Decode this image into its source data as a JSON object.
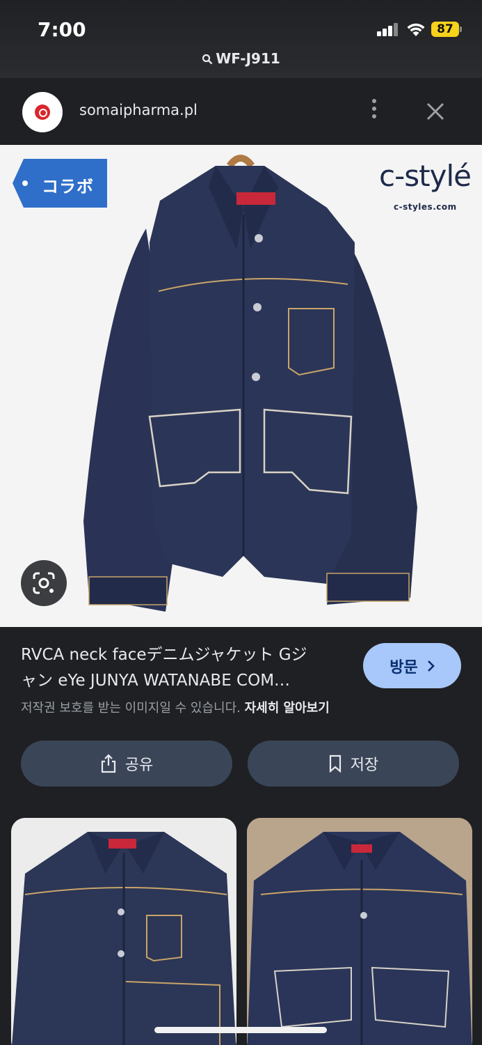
{
  "status_bar": {
    "time": "7:00",
    "battery": "87",
    "search_query": "WF-J911"
  },
  "source": {
    "domain": "somaipharma.pl",
    "favicon": "somaipharma-logo",
    "menu_icon": "more-vert-icon",
    "close_icon": "close-icon"
  },
  "image": {
    "badge_label": "コラボ",
    "watermark": "c-stylé",
    "watermark_url": "c-styles.com",
    "subject": "denim jacket"
  },
  "result": {
    "title_line1": "RVCA neck faceデニムジャケット Gジ",
    "title_line2": "ャン eYe JUNYA WATANABE COM…",
    "visit_label": "방문",
    "copyright_text": "저작권 보호를 받는 이미지일 수 있습니다.",
    "learn_more": "자세히 알아보기"
  },
  "actions": {
    "share_label": "공유",
    "save_label": "저장"
  },
  "colors": {
    "background": "#1f2023",
    "visit_button": "#a8c7fa",
    "action_button": "#3a4558",
    "battery": "#f6d21b",
    "denim": "#2b3557"
  }
}
